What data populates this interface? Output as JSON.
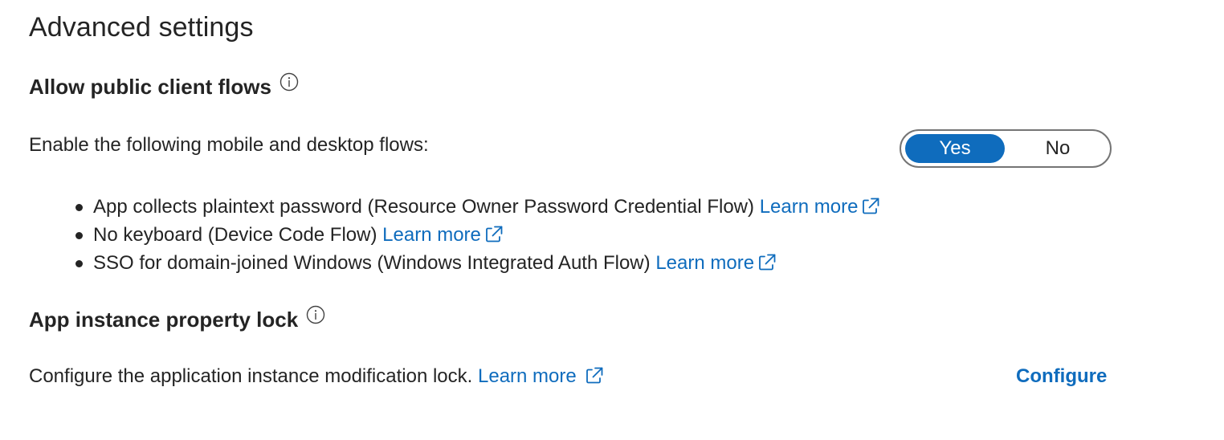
{
  "page": {
    "title": "Advanced settings"
  },
  "public_client_flows": {
    "heading": "Allow public client flows",
    "info_icon": "info-icon",
    "description": "Enable the following mobile and desktop flows:",
    "toggle": {
      "options": [
        "Yes",
        "No"
      ],
      "selected": "Yes"
    },
    "items": [
      {
        "text": "App collects plaintext password (Resource Owner Password Credential Flow)",
        "link_label": "Learn more",
        "link_icon": "external-link-icon"
      },
      {
        "text": "No keyboard (Device Code Flow)",
        "link_label": "Learn more",
        "link_icon": "external-link-icon"
      },
      {
        "text": "SSO for domain-joined Windows (Windows Integrated Auth Flow)",
        "link_label": "Learn more",
        "link_icon": "external-link-icon"
      }
    ]
  },
  "instance_lock": {
    "heading": "App instance property lock",
    "info_icon": "info-icon",
    "description": "Configure the application instance modification lock.",
    "link_label": "Learn more",
    "link_icon": "external-link-icon",
    "action_label": "Configure"
  },
  "colors": {
    "accent": "#0f6cbd",
    "text": "#242424",
    "toggle_border": "#757575",
    "background": "#ffffff"
  }
}
